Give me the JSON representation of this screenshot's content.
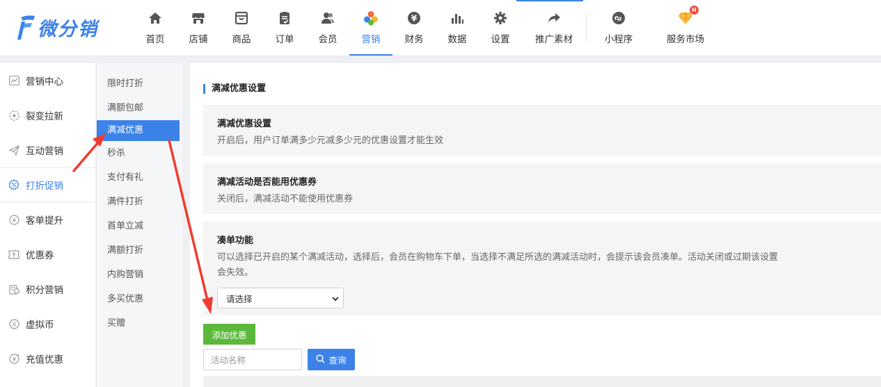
{
  "brand": {
    "name": "微分销",
    "color": "#3c82e8"
  },
  "nav": {
    "items": [
      {
        "label": "首页",
        "icon": "home-icon"
      },
      {
        "label": "店铺",
        "icon": "store-icon"
      },
      {
        "label": "商品",
        "icon": "product-icon"
      },
      {
        "label": "订单",
        "icon": "order-icon"
      },
      {
        "label": "会员",
        "icon": "member-icon"
      },
      {
        "label": "营销",
        "icon": "marketing-icon",
        "active": true
      },
      {
        "label": "财务",
        "icon": "finance-icon"
      },
      {
        "label": "数据",
        "icon": "chart-icon"
      },
      {
        "label": "设置",
        "icon": "gear-icon"
      },
      {
        "label": "推广素材",
        "icon": "share-icon"
      },
      {
        "label": "小程序",
        "icon": "miniprogram-icon"
      },
      {
        "label": "服务市场",
        "icon": "diamond-icon",
        "badge": "H"
      }
    ]
  },
  "sidebar": {
    "items": [
      {
        "label": "营销中心",
        "icon": "trend-icon"
      },
      {
        "label": "裂变拉新",
        "icon": "fission-icon"
      },
      {
        "label": "互动营销",
        "icon": "send-icon"
      },
      {
        "label": "打折促销",
        "icon": "discount-icon",
        "active": true
      },
      {
        "label": "客单提升",
        "icon": "yen-circle-icon"
      },
      {
        "label": "优惠券",
        "icon": "ticket-icon"
      },
      {
        "label": "积分营销",
        "icon": "points-icon"
      },
      {
        "label": "虚拟币",
        "icon": "coin-icon"
      },
      {
        "label": "充值优惠",
        "icon": "recharge-icon"
      }
    ]
  },
  "subnav": {
    "items": [
      {
        "label": "限时打折"
      },
      {
        "label": "满额包邮"
      },
      {
        "label": "满减优惠",
        "active": true
      },
      {
        "label": "秒杀"
      },
      {
        "label": "支付有礼"
      },
      {
        "label": "满件打折"
      },
      {
        "label": "首单立减"
      },
      {
        "label": "满额打折"
      },
      {
        "label": "内购营销"
      },
      {
        "label": "多买优惠"
      },
      {
        "label": "买赠"
      }
    ]
  },
  "main": {
    "section_title": "满减优惠设置",
    "cards": [
      {
        "title": "满减优惠设置",
        "desc": "开启后，用户订单满多少元减多少元的优惠设置才能生效"
      },
      {
        "title": "满减活动是否能用优惠券",
        "desc": "关闭后，满减活动不能使用优惠券"
      },
      {
        "title": "凑单功能",
        "desc": "可以选择已开启的某个满减活动，选择后，会员在购物车下单，当选择不满足所选的满减活动时，会提示该会员凑单。活动关闭或过期该设置会失效。"
      }
    ],
    "select_value": "请选择",
    "add_button": "添加优惠",
    "search_placeholder": "活动名称",
    "query_button": "查询"
  },
  "colors": {
    "primary": "#3c82e8",
    "success": "#5cb83b",
    "annotation": "#f03a2e"
  }
}
